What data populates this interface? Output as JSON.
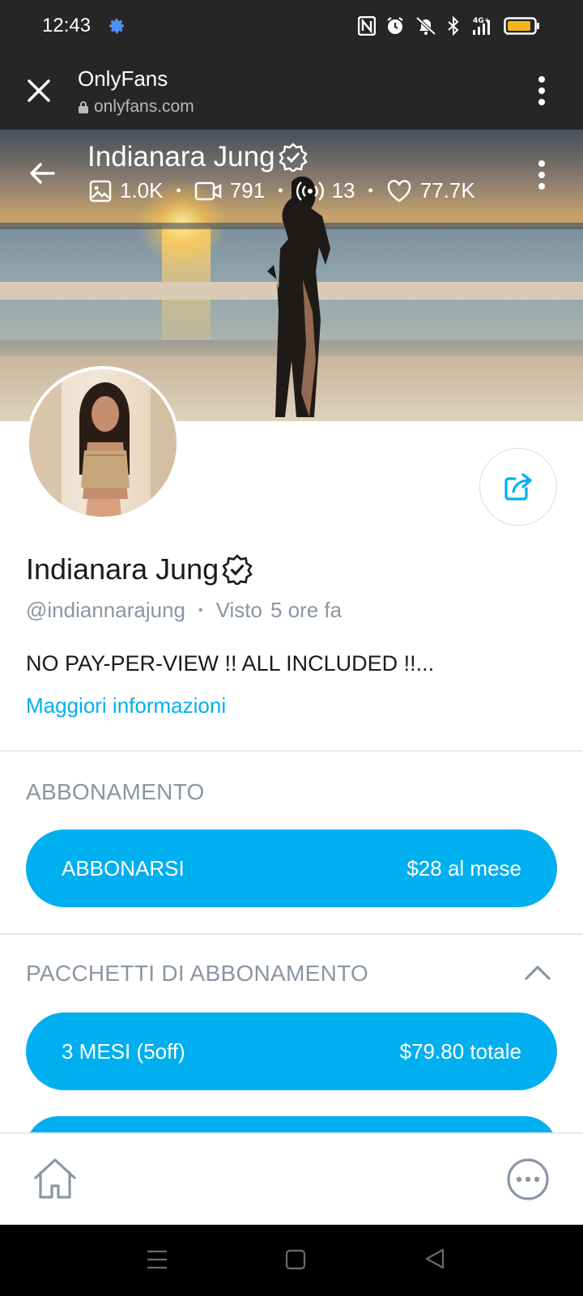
{
  "status_bar": {
    "time": "12:43",
    "icons": [
      "settings-icon",
      "nfc-icon",
      "alarm-icon",
      "mute-icon",
      "bluetooth-icon",
      "signal-4g-icon",
      "battery-icon"
    ],
    "network_label": "4G+"
  },
  "browser": {
    "title": "OnlyFans",
    "url": "onlyfans.com"
  },
  "cover": {
    "name": "Indianara Jung",
    "stats": {
      "photos": "1.0K",
      "videos": "791",
      "streams": "13",
      "likes": "77.7K"
    }
  },
  "profile": {
    "name": "Indianara Jung",
    "username": "@indiannarajung",
    "seen_label": "Visto",
    "seen_time": "5 ore fa",
    "bio": "NO PAY-PER-VIEW !! ALL INCLUDED !!...",
    "more_info": "Maggiori informazioni"
  },
  "subscription": {
    "title": "ABBONAMENTO",
    "button_label": "ABBONARSI",
    "button_price": "$28 al mese"
  },
  "bundles": {
    "title": "PACCHETTI DI ABBONAMENTO",
    "items": [
      {
        "label": "3 MESI (5off)",
        "price": "$79.80 totale"
      }
    ]
  },
  "colors": {
    "accent": "#00aff0",
    "muted": "#8a96a3",
    "dark_bar": "#262626"
  }
}
